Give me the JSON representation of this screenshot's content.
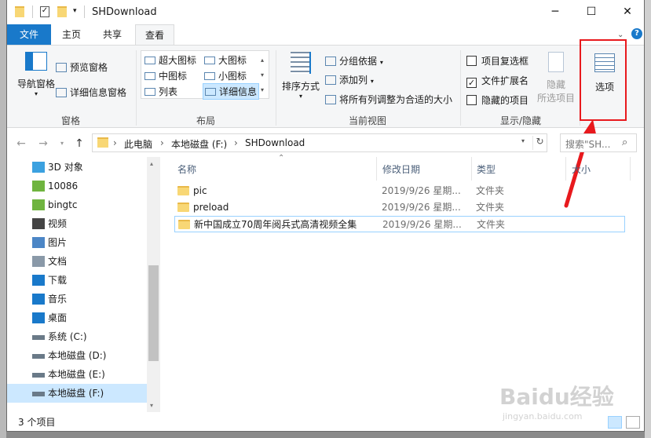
{
  "window": {
    "title": "SHDownload",
    "minimize_glyph": "─",
    "maximize_glyph": "☐",
    "close_glyph": "✕"
  },
  "tabs": [
    "文件",
    "主页",
    "共享",
    "查看"
  ],
  "ribbon": {
    "panes": {
      "nav_pane": "导航窗格",
      "preview_pane": "预览窗格",
      "details_pane": "详细信息窗格",
      "group_label": "窗格"
    },
    "layout": {
      "items": [
        "超大图标",
        "大图标",
        "中图标",
        "小图标",
        "列表",
        "详细信息"
      ],
      "selected": "详细信息",
      "group_label": "布局"
    },
    "current_view": {
      "sort_by": "排序方式",
      "group_by": "分组依据",
      "add_columns": "添加列",
      "size_all_columns": "将所有列调整为合适的大小",
      "group_label": "当前视图"
    },
    "show_hide": {
      "item_checkboxes": {
        "label": "项目复选框",
        "checked": false
      },
      "file_extensions": {
        "label": "文件扩展名",
        "checked": true
      },
      "hidden_items": {
        "label": "隐藏的项目",
        "checked": false
      },
      "hide_selected": "隐藏",
      "hide_selected_2": "所选项目",
      "group_label": "显示/隐藏"
    },
    "options": "选项"
  },
  "address": {
    "crumbs": [
      "此电脑",
      "本地磁盘 (F:)",
      "SHDownload"
    ],
    "search_placeholder": "搜索\"SH..."
  },
  "sidebar": {
    "items": [
      {
        "label": "3D 对象",
        "icon": "3d-objects-icon"
      },
      {
        "label": "10086",
        "icon": "user-folder-icon"
      },
      {
        "label": "bingtc",
        "icon": "user-folder-icon"
      },
      {
        "label": "视频",
        "icon": "video-icon"
      },
      {
        "label": "图片",
        "icon": "pictures-icon"
      },
      {
        "label": "文档",
        "icon": "documents-icon"
      },
      {
        "label": "下载",
        "icon": "download-icon"
      },
      {
        "label": "音乐",
        "icon": "music-icon"
      },
      {
        "label": "桌面",
        "icon": "desktop-icon"
      },
      {
        "label": "系统 (C:)",
        "icon": "system-drive-icon"
      },
      {
        "label": "本地磁盘 (D:)",
        "icon": "drive-icon"
      },
      {
        "label": "本地磁盘 (E:)",
        "icon": "drive-icon"
      },
      {
        "label": "本地磁盘 (F:)",
        "icon": "drive-icon"
      }
    ],
    "selected_index": 12
  },
  "columns": [
    "名称",
    "修改日期",
    "类型",
    "大小"
  ],
  "files": [
    {
      "name": "pic",
      "date": "2019/9/26 星期...",
      "type": "文件夹"
    },
    {
      "name": "preload",
      "date": "2019/9/26 星期...",
      "type": "文件夹"
    },
    {
      "name": "新中国成立70周年阅兵式高清视频全集",
      "date": "2019/9/26 星期...",
      "type": "文件夹"
    }
  ],
  "status": {
    "item_count": "3 个项目"
  },
  "watermark": {
    "text": "Baidu经验",
    "sub": "jingyan.baidu.com"
  },
  "colors": {
    "accent": "#1979ca",
    "selection": "#cce8ff",
    "highlight_box": "#e8191d",
    "arrow": "#e8191d"
  }
}
